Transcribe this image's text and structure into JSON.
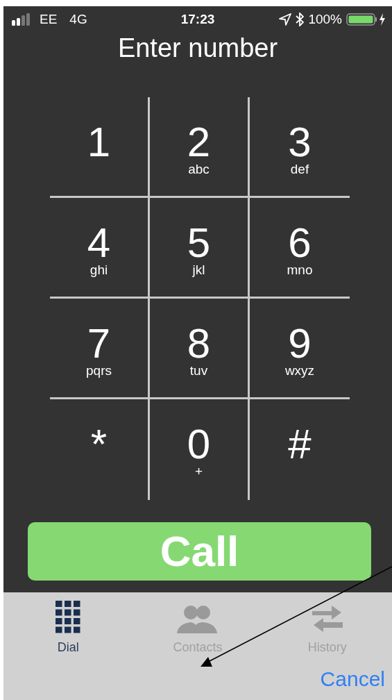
{
  "status_bar": {
    "carrier": "EE",
    "network": "4G",
    "time": "17:23",
    "battery": "100%"
  },
  "title": "Enter number",
  "keys": [
    {
      "digit": "1"
    },
    {
      "digit": "2",
      "letters": "abc"
    },
    {
      "digit": "3",
      "letters": "def"
    },
    {
      "digit": "4",
      "letters": "ghi"
    },
    {
      "digit": "5",
      "letters": "jkl"
    },
    {
      "digit": "6",
      "letters": "mno"
    },
    {
      "digit": "7",
      "letters": "pqrs"
    },
    {
      "digit": "8",
      "letters": "tuv"
    },
    {
      "digit": "9",
      "letters": "wxyz"
    },
    {
      "digit": "*"
    },
    {
      "digit": "0",
      "letters": "+"
    },
    {
      "digit": "#"
    }
  ],
  "call_button": "Call",
  "tabs": [
    {
      "label": "Dial",
      "kind": "dial",
      "selected": true
    },
    {
      "label": "Contacts",
      "kind": "contacts",
      "selected": false
    },
    {
      "label": "History",
      "kind": "history",
      "selected": false
    }
  ],
  "cancel": "Cancel"
}
